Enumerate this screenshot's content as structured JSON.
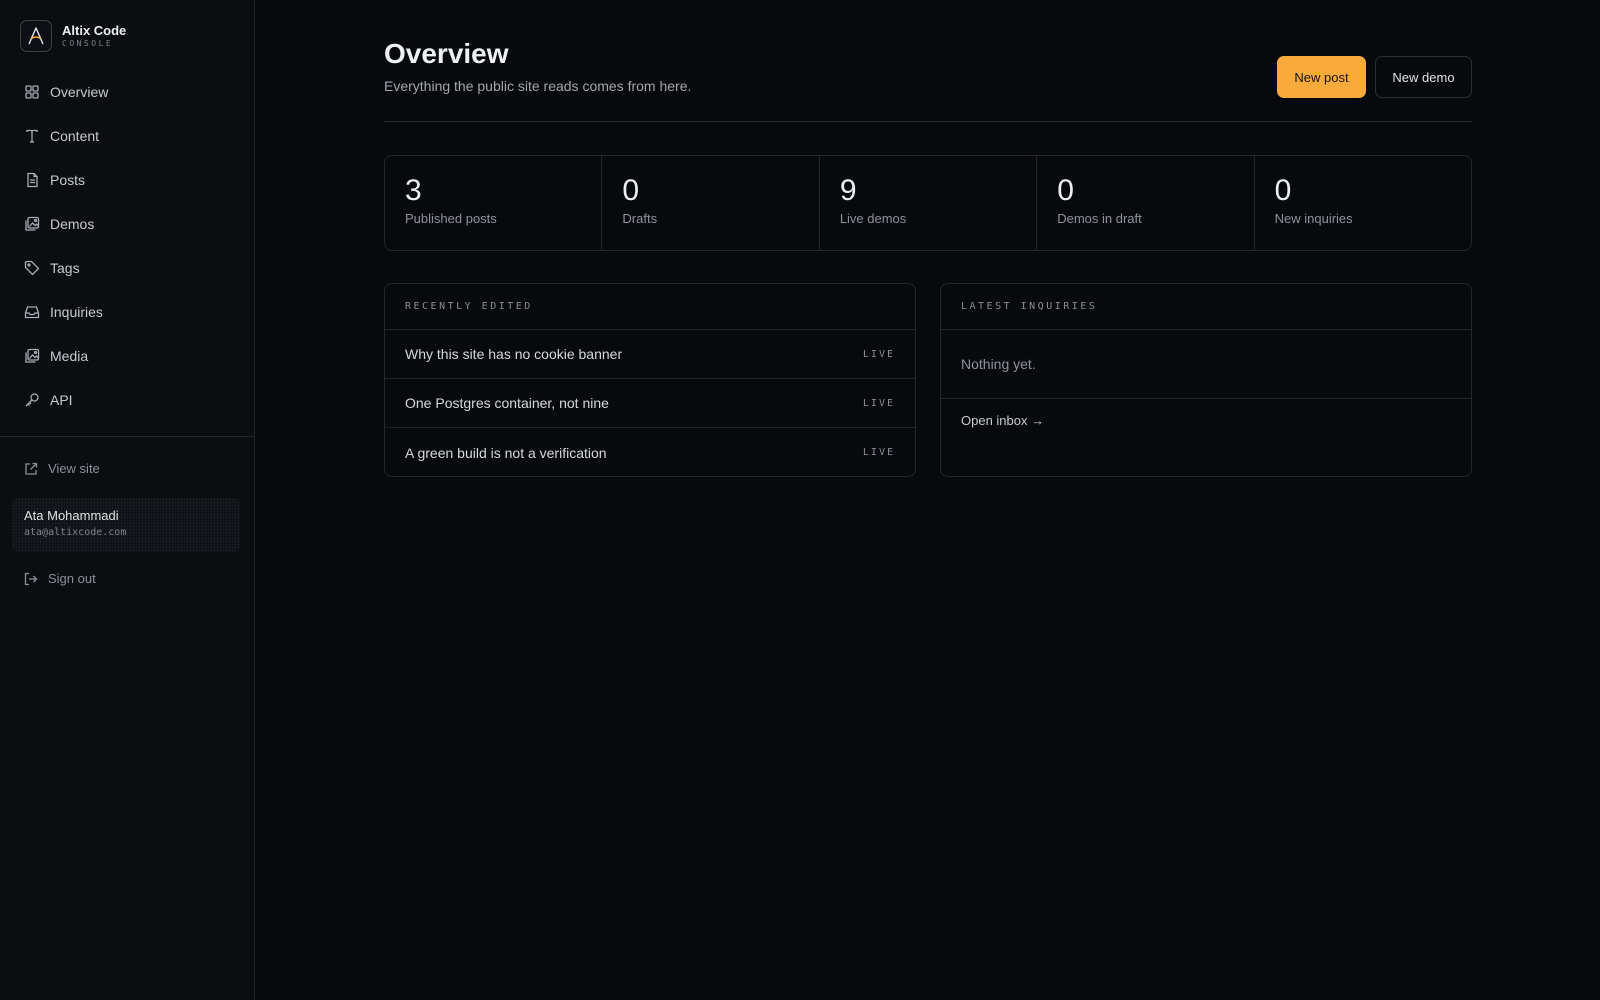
{
  "brand": {
    "name": "Altix Code",
    "sub": "CONSOLE"
  },
  "sidebar": {
    "items": [
      {
        "label": "Overview",
        "icon": "grid-icon"
      },
      {
        "label": "Content",
        "icon": "text-icon"
      },
      {
        "label": "Posts",
        "icon": "document-icon"
      },
      {
        "label": "Demos",
        "icon": "images-icon"
      },
      {
        "label": "Tags",
        "icon": "tag-icon"
      },
      {
        "label": "Inquiries",
        "icon": "inbox-icon"
      },
      {
        "label": "Media",
        "icon": "images-icon"
      },
      {
        "label": "API",
        "icon": "key-icon"
      }
    ],
    "view_site": "View site",
    "user": {
      "name": "Ata Mohammadi",
      "email": "ata@altixcode.com"
    },
    "sign_out": "Sign out"
  },
  "header": {
    "title": "Overview",
    "subtitle": "Everything the public site reads comes from here.",
    "new_post": "New post",
    "new_demo": "New demo"
  },
  "stats": [
    {
      "value": "3",
      "label": "Published posts"
    },
    {
      "value": "0",
      "label": "Drafts"
    },
    {
      "value": "9",
      "label": "Live demos"
    },
    {
      "value": "0",
      "label": "Demos in draft"
    },
    {
      "value": "0",
      "label": "New inquiries"
    }
  ],
  "recent": {
    "heading": "RECENTLY EDITED",
    "rows": [
      {
        "title": "Why this site has no cookie banner",
        "status": "LIVE"
      },
      {
        "title": "One Postgres container, not nine",
        "status": "LIVE"
      },
      {
        "title": "A green build is not a verification",
        "status": "LIVE"
      }
    ]
  },
  "inquiries": {
    "heading": "LATEST INQUIRIES",
    "empty": "Nothing yet.",
    "link": "Open inbox →"
  },
  "colors": {
    "accent": "#f8ab3b",
    "background": "#07090d",
    "sidebar": "#0b0d11"
  }
}
